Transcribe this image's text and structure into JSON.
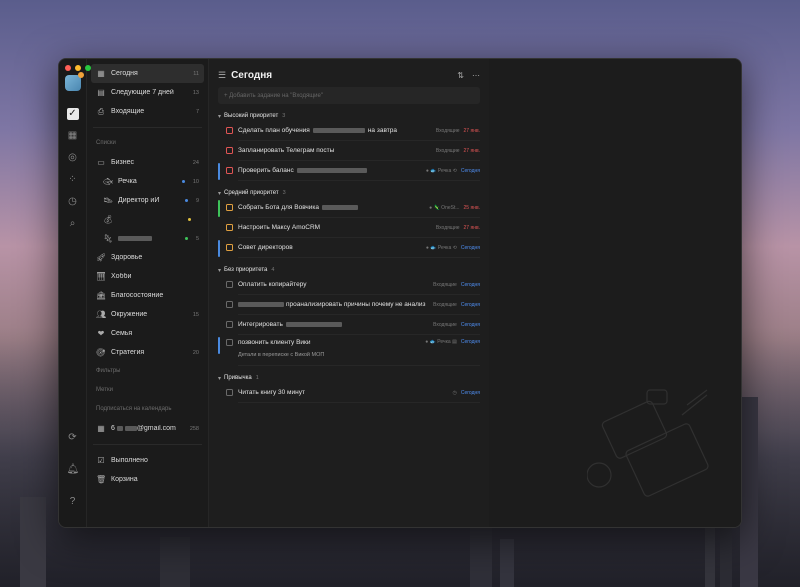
{
  "colors": {
    "red": "#e05555",
    "orange": "#e0a040",
    "blue": "#4a8ae0",
    "gray": "#6a6a6a",
    "green": "#3ec35a",
    "accent_date": "#4f8ef0"
  },
  "sidebar": {
    "top": [
      {
        "icon": "calendar-icon",
        "label": "Сегодня",
        "count": "11",
        "active": true
      },
      {
        "icon": "calendar-week-icon",
        "label": "Следующие 7 дней",
        "count": "13"
      },
      {
        "icon": "inbox-icon",
        "label": "Входящие",
        "count": "7"
      }
    ],
    "lists_header": "Списки",
    "lists": [
      {
        "icon": "folder-icon",
        "label": "Бизнес",
        "count": "24",
        "expand": "▾"
      },
      {
        "icon": "fish-icon",
        "label": "Речка",
        "count": "10",
        "dot": "#4a8ae0",
        "sub": true
      },
      {
        "icon": "shoe-icon",
        "label": "Директор иИ",
        "count": "9",
        "dot": "#4a8ae0",
        "sub": true
      },
      {
        "icon": "money-bag-icon",
        "label": "",
        "count": "",
        "dot": "#e0c040",
        "sub": true,
        "blurred": true,
        "blur_w": 0
      },
      {
        "icon": "gecko-icon",
        "label": "",
        "count": "5",
        "dot": "#3ec35a",
        "sub": true,
        "blurred": true,
        "blur_w": 34
      },
      {
        "icon": "rocket-icon",
        "label": "Здоровье",
        "count": ""
      },
      {
        "icon": "piano-icon",
        "label": "Хобби",
        "count": ""
      },
      {
        "icon": "bank-icon",
        "label": "Благосостояние",
        "count": ""
      },
      {
        "icon": "people-icon",
        "label": "Окружение",
        "count": "15"
      },
      {
        "icon": "heart-icon",
        "label": "Семья",
        "count": ""
      },
      {
        "icon": "target-icon",
        "label": "Стратегия",
        "count": "20"
      }
    ],
    "filters_header": "Фильтры",
    "tags_header": "Метки",
    "calendar_header": "Подписаться на календарь",
    "calendar_account": {
      "prefix": "6",
      "suffix": "@gmail.com",
      "count": "258"
    },
    "bottom": [
      {
        "icon": "checkbox-done-icon",
        "label": "Выполнено"
      },
      {
        "icon": "trash-icon",
        "label": "Корзина"
      }
    ]
  },
  "main": {
    "title": "Сегодня",
    "add_placeholder": "+ Добавить задание на \"Входящие\"",
    "groups": [
      {
        "name": "Высокий приоритет",
        "count": "3",
        "tasks": [
          {
            "text": "Сделать план обучения",
            "blur_mid": 52,
            "text2": "на завтра",
            "meta": "Входящие",
            "date": "27 янв.",
            "date_color": "#e05555",
            "cb": "#e05555",
            "bar": ""
          },
          {
            "text": "Запланировать Телеграм посты",
            "meta": "Входящие",
            "date": "27 янв.",
            "date_color": "#e05555",
            "cb": "#e05555",
            "bar": ""
          },
          {
            "text": "Проверить баланс",
            "blur_mid": 70,
            "meta": "● 🐟 Речка  ⟲",
            "date": "Сегодня",
            "date_color": "#4f8ef0",
            "cb": "#e05555",
            "bar": "#4a8ae0"
          }
        ]
      },
      {
        "name": "Средний приоритет",
        "count": "3",
        "tasks": [
          {
            "text": "Собрать Бота для Вовчика",
            "blur_mid": 36,
            "meta": "● 🦎 OneSt...",
            "date": "25 янв.",
            "date_color": "#e05555",
            "cb": "#e0a040",
            "bar": "#3ec35a"
          },
          {
            "text": "Настроить Максу AmoCRM",
            "meta": "Входящие",
            "date": "27 янв.",
            "date_color": "#e05555",
            "cb": "#e0a040",
            "bar": ""
          },
          {
            "text": "Совет директоров",
            "meta": "● 🐟 Речка  ⟲",
            "date": "Сегодня",
            "date_color": "#4f8ef0",
            "cb": "#e0a040",
            "bar": "#4a8ae0"
          }
        ]
      },
      {
        "name": "Без приоритета",
        "count": "4",
        "tasks": [
          {
            "text": "Оплатить копирайтеру",
            "meta": "Входящие",
            "date": "Сегодня",
            "date_color": "#4f8ef0",
            "cb": "#6a6a6a",
            "bar": ""
          },
          {
            "text": "",
            "blur_lead": 46,
            "text2": "проанализировать причины почему не анализ",
            "meta": "Входящие",
            "date": "Сегодня",
            "date_color": "#4f8ef0",
            "cb": "#6a6a6a",
            "bar": ""
          },
          {
            "text": "Интегрировать",
            "blur_mid": 56,
            "meta": "Входящие",
            "date": "Сегодня",
            "date_color": "#4f8ef0",
            "cb": "#6a6a6a",
            "bar": ""
          },
          {
            "text": "позвонить клиенту Вики",
            "subtext": "Детали в переписке с Викой МОП",
            "meta": "● 🐟 Речка  ▤",
            "date": "Сегодня",
            "date_color": "#4f8ef0",
            "cb": "#6a6a6a",
            "bar": "#4a8ae0",
            "tall": true
          }
        ]
      },
      {
        "name": "Привычка",
        "count": "1",
        "tasks": [
          {
            "text": "Читать книгу 30 минут",
            "meta": "◷",
            "date": "Сегодня",
            "date_color": "#4f8ef0",
            "cb": "#6a6a6a",
            "bar": ""
          }
        ]
      }
    ]
  }
}
